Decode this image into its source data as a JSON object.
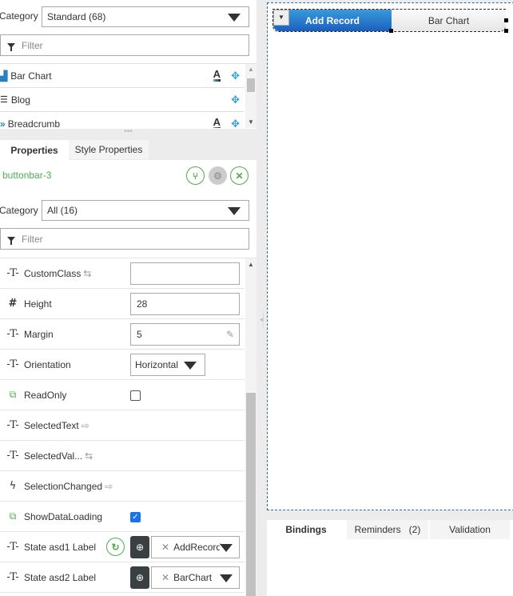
{
  "toolbox": {
    "category_label": "Category",
    "category_value": "Standard (68)",
    "filter_placeholder": "Filter",
    "items": [
      {
        "label": "Bar Chart",
        "icon": "bar-chart-icon",
        "style": true
      },
      {
        "label": "Blog",
        "icon": "blog-icon",
        "style": false
      },
      {
        "label": "Breadcrumb",
        "icon": "breadcrumb-icon",
        "style": true
      }
    ],
    "style_glyph": "A"
  },
  "tabs": {
    "properties": "Properties",
    "style_properties": "Style Properties"
  },
  "selected_control": "buttonbar-3",
  "properties": {
    "category_label": "Category",
    "category_value": "All (16)",
    "filter_placeholder": "Filter",
    "rows": [
      {
        "name": "CustomClass",
        "value": ""
      },
      {
        "name": "Height",
        "value": "28"
      },
      {
        "name": "Margin",
        "value": "5"
      },
      {
        "name": "Orientation",
        "value": "Horizontal"
      },
      {
        "name": "ReadOnly",
        "checked": false
      },
      {
        "name": "SelectedText"
      },
      {
        "name": "SelectedVal..."
      },
      {
        "name": "SelectionChanged"
      },
      {
        "name": "ShowDataLoading",
        "checked": true
      },
      {
        "name": "State asd1 Label",
        "value": "AddRecord"
      },
      {
        "name": "State asd2 Label",
        "value": "BarChart"
      }
    ]
  },
  "canvas": {
    "buttons": [
      "Add Record",
      "Bar Chart"
    ]
  },
  "bottom_tabs": {
    "bindings": "Bindings",
    "reminders": "Reminders",
    "reminders_count": "(2)",
    "validation": "Validation"
  },
  "colors": {
    "accent_green": "#4cae4c",
    "active_button": "#1a5fc0"
  }
}
